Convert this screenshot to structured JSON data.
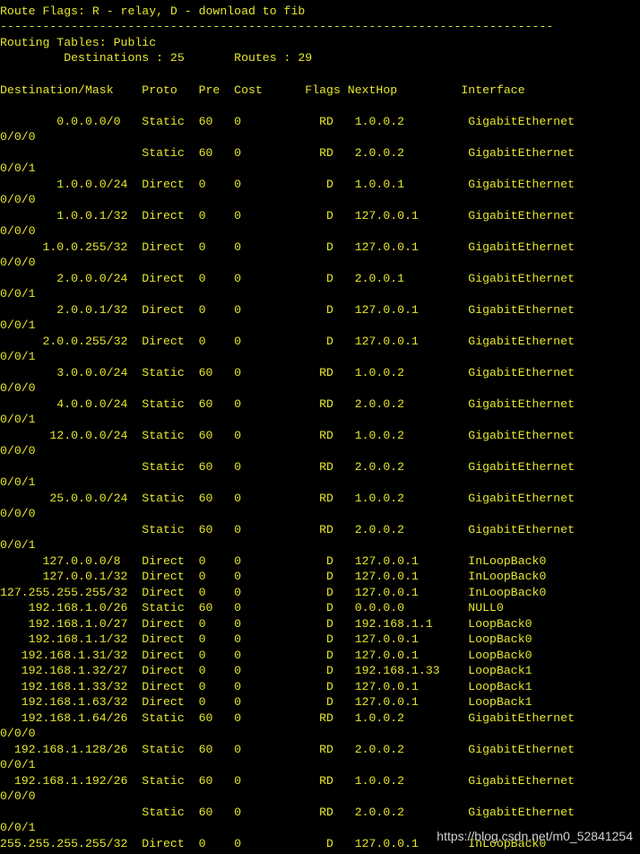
{
  "terminal": {
    "text_color": "#e6e62c",
    "background_color": "#000000",
    "lines": [
      "Route Flags: R - relay, D - download to fib",
      "------------------------------------------------------------------------------",
      "Routing Tables: Public",
      "         Destinations : 25       Routes : 29",
      "",
      "Destination/Mask    Proto   Pre  Cost      Flags NextHop         Interface",
      "",
      "        0.0.0.0/0   Static  60   0           RD   1.0.0.2         GigabitEthernet",
      "0/0/0",
      "                    Static  60   0           RD   2.0.0.2         GigabitEthernet",
      "0/0/1",
      "        1.0.0.0/24  Direct  0    0            D   1.0.0.1         GigabitEthernet",
      "0/0/0",
      "        1.0.0.1/32  Direct  0    0            D   127.0.0.1       GigabitEthernet",
      "0/0/0",
      "      1.0.0.255/32  Direct  0    0            D   127.0.0.1       GigabitEthernet",
      "0/0/0",
      "        2.0.0.0/24  Direct  0    0            D   2.0.0.1         GigabitEthernet",
      "0/0/1",
      "        2.0.0.1/32  Direct  0    0            D   127.0.0.1       GigabitEthernet",
      "0/0/1",
      "      2.0.0.255/32  Direct  0    0            D   127.0.0.1       GigabitEthernet",
      "0/0/1",
      "        3.0.0.0/24  Static  60   0           RD   1.0.0.2         GigabitEthernet",
      "0/0/0",
      "        4.0.0.0/24  Static  60   0           RD   2.0.0.2         GigabitEthernet",
      "0/0/1",
      "       12.0.0.0/24  Static  60   0           RD   1.0.0.2         GigabitEthernet",
      "0/0/0",
      "                    Static  60   0           RD   2.0.0.2         GigabitEthernet",
      "0/0/1",
      "       25.0.0.0/24  Static  60   0           RD   1.0.0.2         GigabitEthernet",
      "0/0/0",
      "                    Static  60   0           RD   2.0.0.2         GigabitEthernet",
      "0/0/1",
      "      127.0.0.0/8   Direct  0    0            D   127.0.0.1       InLoopBack0",
      "      127.0.0.1/32  Direct  0    0            D   127.0.0.1       InLoopBack0",
      "127.255.255.255/32  Direct  0    0            D   127.0.0.1       InLoopBack0",
      "    192.168.1.0/26  Static  60   0            D   0.0.0.0         NULL0",
      "    192.168.1.0/27  Direct  0    0            D   192.168.1.1     LoopBack0",
      "    192.168.1.1/32  Direct  0    0            D   127.0.0.1       LoopBack0",
      "   192.168.1.31/32  Direct  0    0            D   127.0.0.1       LoopBack0",
      "   192.168.1.32/27  Direct  0    0            D   192.168.1.33    LoopBack1",
      "   192.168.1.33/32  Direct  0    0            D   127.0.0.1       LoopBack1",
      "   192.168.1.63/32  Direct  0    0            D   127.0.0.1       LoopBack1",
      "   192.168.1.64/26  Static  60   0           RD   1.0.0.2         GigabitEthernet",
      "0/0/0",
      "  192.168.1.128/26  Static  60   0           RD   2.0.0.2         GigabitEthernet",
      "0/0/1",
      "  192.168.1.192/26  Static  60   0           RD   1.0.0.2         GigabitEthernet",
      "0/0/0",
      "                    Static  60   0           RD   2.0.0.2         GigabitEthernet",
      "0/0/1",
      "255.255.255.255/32  Direct  0    0            D   127.0.0.1       InLoopBack0"
    ]
  },
  "watermark": {
    "text": "https://blog.csdn.net/m0_52841254"
  }
}
